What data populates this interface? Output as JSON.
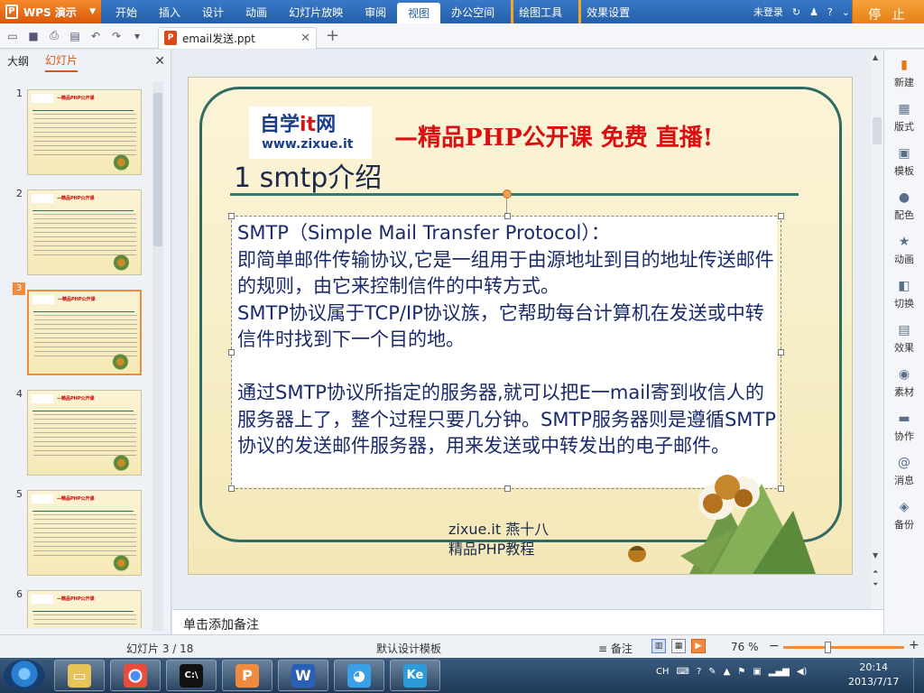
{
  "app": {
    "name": "WPS 演示",
    "menu": [
      "开始",
      "插入",
      "设计",
      "动画",
      "幻灯片放映",
      "审阅",
      "视图",
      "办公空间"
    ],
    "active_menu": "视图",
    "tool_tabs": [
      "绘图工具",
      "效果设置"
    ],
    "login": "未登录",
    "stop_label": "停 止"
  },
  "document": {
    "tab_name": "email发送.ppt"
  },
  "left_panel": {
    "tabs": [
      "大纲",
      "幻灯片"
    ],
    "active_tab": "幻灯片",
    "thumbnails": [
      {
        "num": "1"
      },
      {
        "num": "2"
      },
      {
        "num": "3"
      },
      {
        "num": "4"
      },
      {
        "num": "5"
      },
      {
        "num": "6"
      }
    ],
    "selected": "3"
  },
  "slide": {
    "logo_line1_a": "自学",
    "logo_line1_b": "it",
    "logo_line1_c": "网",
    "logo_line2": "www.zixue.it",
    "headline": "—精品PHP公开课  免费  直播!",
    "title": "1 smtp介绍",
    "body": {
      "p1": "SMTP（Simple Mail Transfer Protocol）：",
      "p2": "即简单邮件传输协议,它是一组用于由源地址到目的地址传送邮件的规则，由它来控制信件的中转方式。",
      "p3": "SMTP协议属于TCP/IP协议族，它帮助每台计算机在发送或中转信件时找到下一个目的地。",
      "p4": "通过SMTP协议所指定的服务器,就可以把E一mail寄到收信人的服务器上了，整个过程只要几分钟。SMTP服务器则是遵循SMTP协议的发送邮件服务器，用来发送或中转发出的电子邮件。"
    },
    "footer_line1": "zixue.it 燕十八",
    "footer_line2": "精品PHP教程"
  },
  "notes": {
    "placeholder": "单击添加备注"
  },
  "right_pane": {
    "items": [
      {
        "label": "新建",
        "icon": "new-icon"
      },
      {
        "label": "版式",
        "icon": "layout-icon"
      },
      {
        "label": "模板",
        "icon": "template-icon"
      },
      {
        "label": "配色",
        "icon": "palette-icon"
      },
      {
        "label": "动画",
        "icon": "animation-icon"
      },
      {
        "label": "切换",
        "icon": "transition-icon"
      },
      {
        "label": "效果",
        "icon": "effect-icon"
      },
      {
        "label": "素材",
        "icon": "material-icon"
      },
      {
        "label": "协作",
        "icon": "collab-icon"
      },
      {
        "label": "消息",
        "icon": "message-icon"
      },
      {
        "label": "备份",
        "icon": "backup-icon"
      }
    ]
  },
  "status": {
    "slide_counter": "幻灯片 3 / 18",
    "template": "默认设计模板",
    "notes_label": "备注",
    "zoom": "76 %",
    "zoom_level": 0.36
  },
  "taskbar": {
    "ime": "CH",
    "time": "20:14",
    "date": "2013/7/17"
  },
  "colors": {
    "accent_orange": "#f08a3c",
    "title_blue": "#245fa8",
    "headline_red": "#d81010",
    "frame_green": "#2f6b62"
  }
}
